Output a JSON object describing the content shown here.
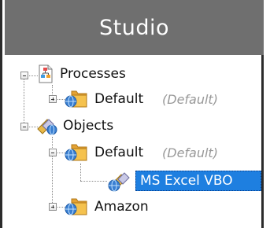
{
  "header": {
    "title": "Studio"
  },
  "tree": {
    "processes": {
      "label": "Processes"
    },
    "processes_default": {
      "label": "Default",
      "sub": "(Default)"
    },
    "objects": {
      "label": "Objects"
    },
    "objects_default": {
      "label": "Default",
      "sub": "(Default)"
    },
    "ms_excel": {
      "label": "MS Excel VBO"
    },
    "amazon": {
      "label": "Amazon"
    }
  },
  "colors": {
    "header_bg": "#6f6f6f",
    "selection": "#1e7fe0",
    "folder": "#f0b33a",
    "globe": "#3a7fd1"
  },
  "icons": [
    "process-icon",
    "folder-icon",
    "globe-icon",
    "objects-icon",
    "object-vbo-icon"
  ]
}
